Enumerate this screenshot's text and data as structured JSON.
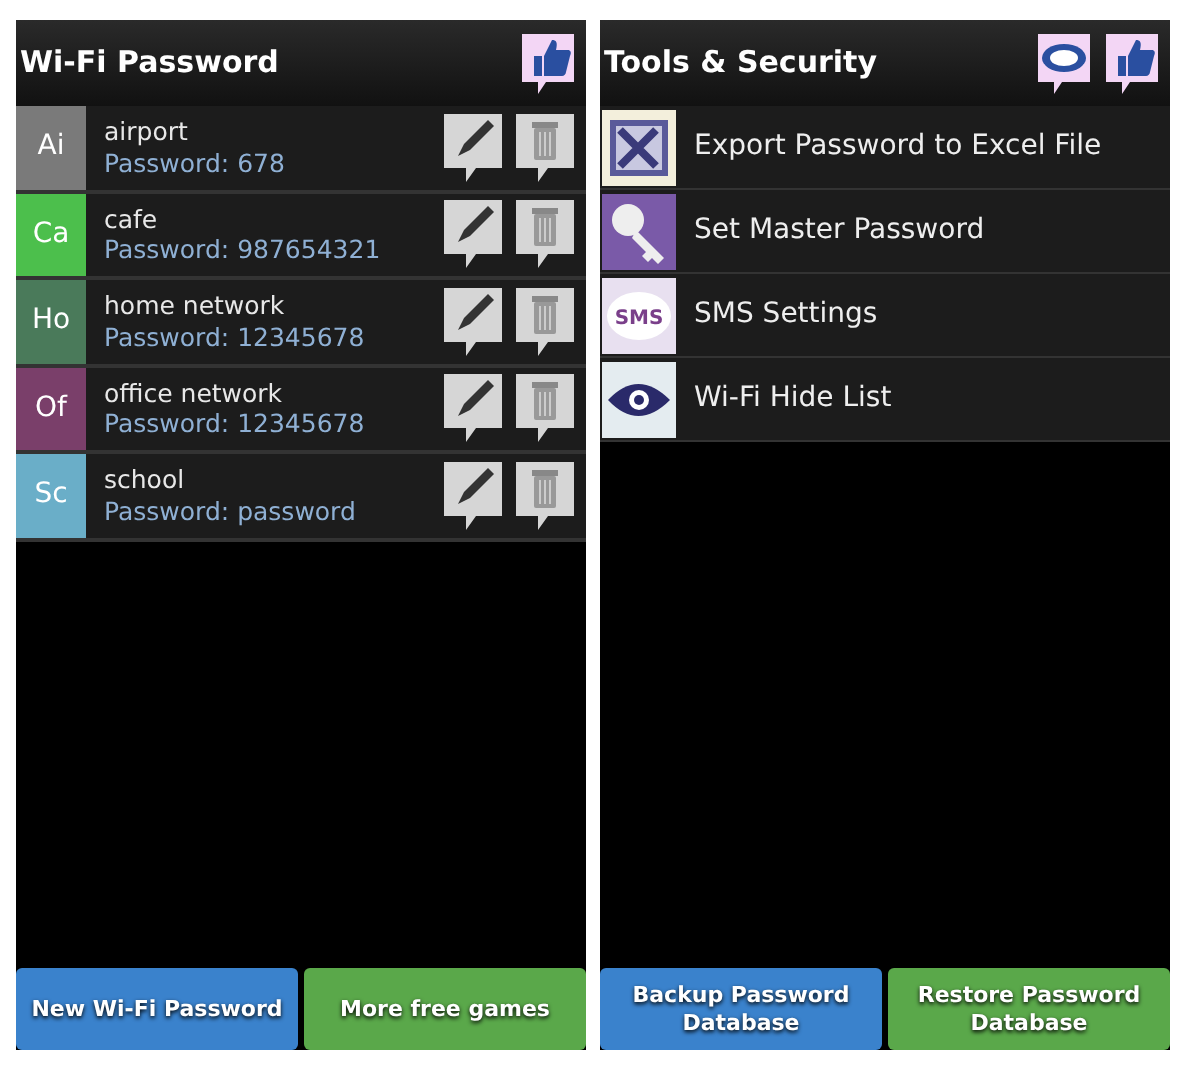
{
  "left_screen": {
    "title": "Wi-Fi Password",
    "networks": [
      {
        "initials": "Ai",
        "color": "#7a7a7a",
        "name": "airport",
        "password": "Password: 678"
      },
      {
        "initials": "Ca",
        "color": "#4cbf4c",
        "name": "cafe",
        "password": "Password: 987654321"
      },
      {
        "initials": "Ho",
        "color": "#4a7a5a",
        "name": "home network",
        "password": "Password: 12345678"
      },
      {
        "initials": "Of",
        "color": "#7a3f6a",
        "name": "office network",
        "password": "Password: 12345678"
      },
      {
        "initials": "Sc",
        "color": "#6aaec8",
        "name": "school",
        "password": "Password: password"
      }
    ],
    "buttons": [
      {
        "label": "New Wi-Fi Password",
        "color": "#3a82cc"
      },
      {
        "label": "More free games",
        "color": "#5aa84a"
      }
    ]
  },
  "right_screen": {
    "title": "Tools & Security",
    "tools": [
      {
        "kind": "excel",
        "label": "Export Password to Excel File"
      },
      {
        "kind": "key",
        "label": "Set Master Password"
      },
      {
        "kind": "sms",
        "icon_text": "SMS",
        "label": "SMS Settings"
      },
      {
        "kind": "eye",
        "label": "Wi-Fi Hide List"
      }
    ],
    "buttons": [
      {
        "label": "Backup Password Database",
        "color": "#3a82cc"
      },
      {
        "label": "Restore Password Database",
        "color": "#5aa84a"
      }
    ]
  }
}
